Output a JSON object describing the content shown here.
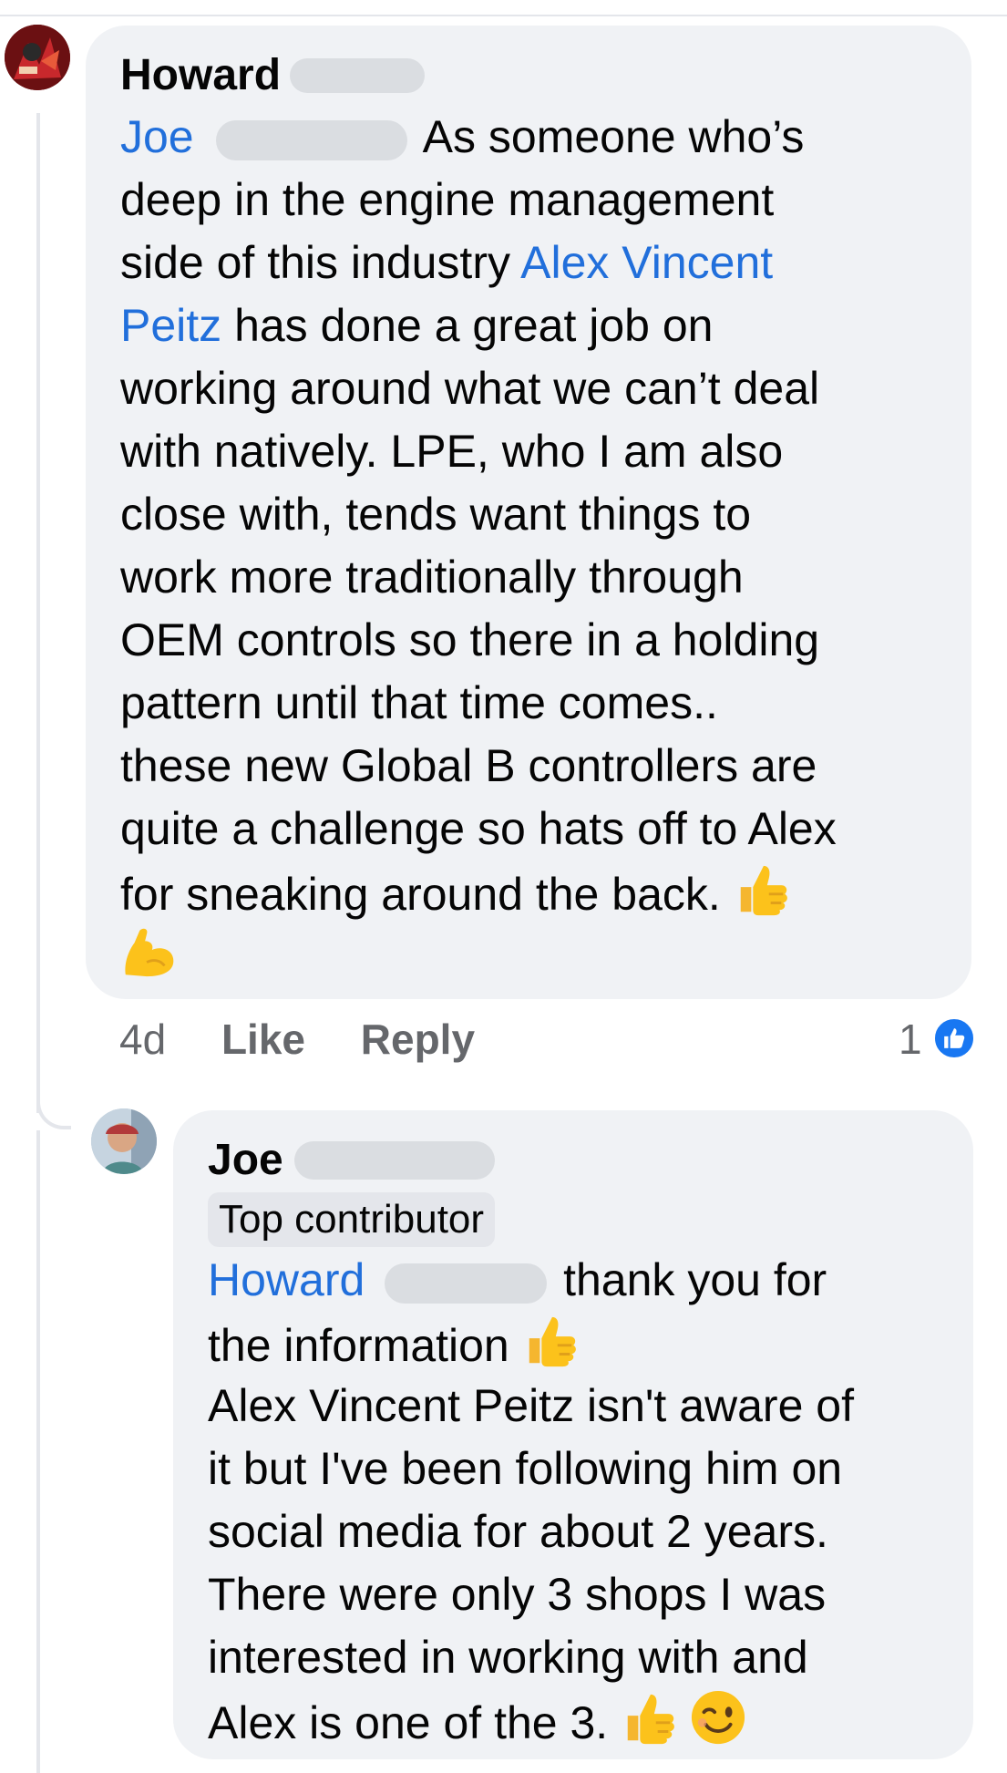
{
  "comment1": {
    "author": "Howard",
    "lines": [
      {
        "mention": "Joe",
        "text": "As someone who’s"
      },
      {
        "text": "deep in the engine management"
      },
      {
        "text": "side of this industry ",
        "mention_end": "Alex Vincent"
      },
      {
        "mention": "Peitz",
        "text": " has done a great job on"
      },
      {
        "text": "working around what we can’t deal"
      },
      {
        "text": "with natively. LPE, who I am also"
      },
      {
        "text": "close with, tends want things to"
      },
      {
        "text": "work more traditionally through"
      },
      {
        "text": "OEM controls so there in a holding"
      },
      {
        "text": "pattern until that time comes.."
      },
      {
        "text": "these new Global B controllers are"
      },
      {
        "text": "quite a challenge so hats off to Alex"
      },
      {
        "text": "for sneaking around the back. "
      }
    ],
    "emojis": [
      "thumbs-up",
      "flexed-biceps"
    ],
    "time": "4d",
    "like_label": "Like",
    "reply_label": "Reply",
    "reaction_count": "1"
  },
  "comment2": {
    "author": "Joe",
    "badge": "Top contributor",
    "lines": [
      {
        "mention": "Howard",
        "text": "thank you for"
      },
      {
        "text": "the information "
      },
      {
        "text": "Alex Vincent Peitz isn't aware of"
      },
      {
        "text": "it but I've been following him on"
      },
      {
        "text": "social media for about 2 years."
      },
      {
        "text": "There were only 3 shops I was"
      },
      {
        "text": "interested in working with and"
      },
      {
        "text": "Alex is one of the 3. "
      }
    ],
    "emojis": [
      "thumbs-up",
      "winking-face"
    ]
  },
  "colors": {
    "mention": "#216fdb",
    "bubble": "#f0f2f5",
    "like_blue": "#1877f2",
    "meta_gray": "#65676b"
  }
}
